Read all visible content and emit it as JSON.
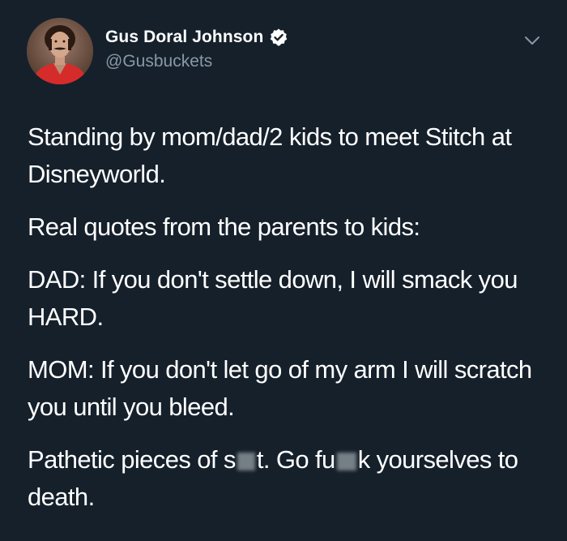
{
  "user": {
    "display_name": "Gus Doral Johnson",
    "handle": "@Gusbuckets",
    "verified": true,
    "avatar_icon": "profile-photo"
  },
  "menu": {
    "icon": "chevron-down-icon"
  },
  "tweet": {
    "paragraph_1": "Standing by mom/dad/2 kids to meet Stitch at Disneyworld.",
    "paragraph_2": "Real quotes from the parents to kids:",
    "paragraph_3": "DAD: If you don't settle down, I will smack you HARD.",
    "paragraph_4": "MOM: If you don't let go of my arm I will scratch you until you bleed.",
    "paragraph_5": {
      "part_1": "Pathetic pieces of s",
      "part_2": "t. Go fu",
      "part_3": "k yourselves to death."
    }
  },
  "colors": {
    "background": "#15202b",
    "text": "#ffffff",
    "secondary_text": "#8899a6",
    "verified_badge": "#ffffff"
  }
}
